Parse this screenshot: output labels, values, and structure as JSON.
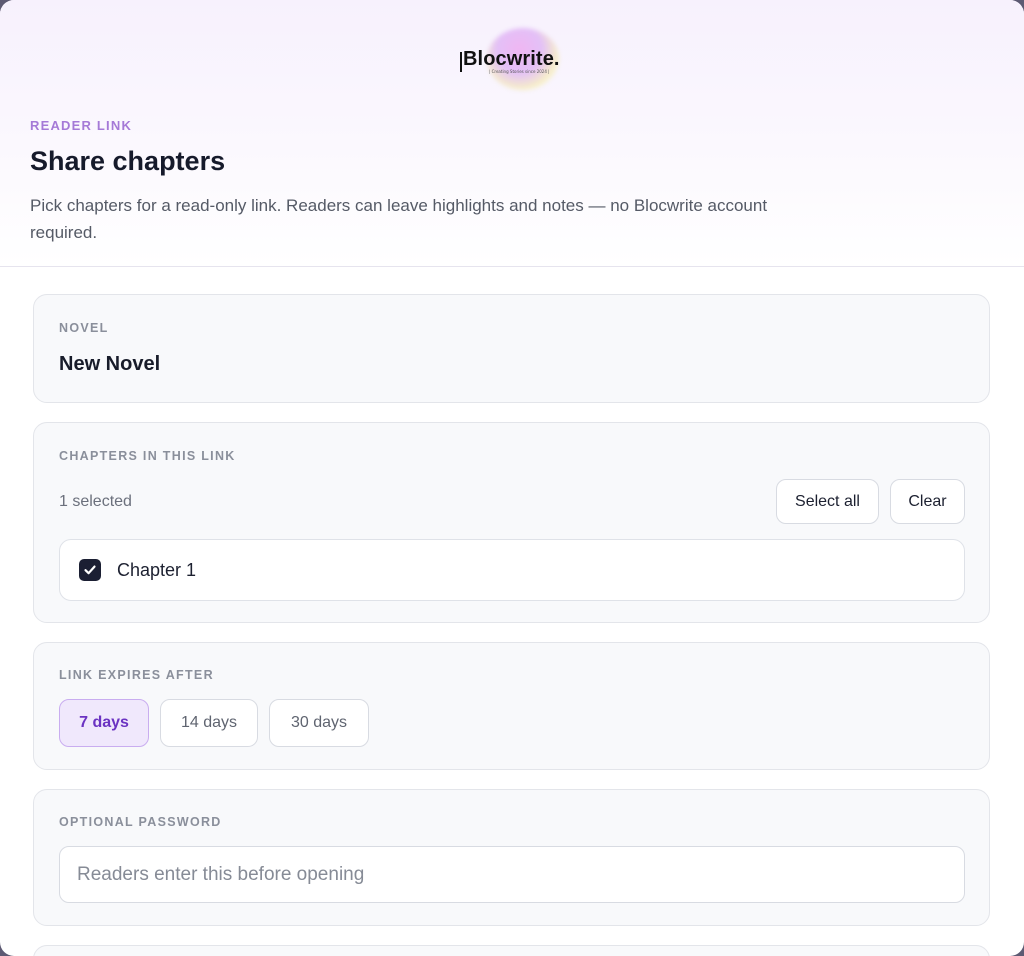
{
  "brand": {
    "name": "Blocwrite.",
    "tagline": "| Creating Stories since 2024 |"
  },
  "header": {
    "eyebrow": "READER LINK",
    "title": "Share chapters",
    "description": "Pick chapters for a read-only link. Readers can leave highlights and notes — no Blocwrite account required."
  },
  "novel": {
    "label": "NOVEL",
    "name": "New Novel"
  },
  "chapters": {
    "label": "CHAPTERS IN THIS LINK",
    "selected_count": "1 selected",
    "select_all_label": "Select all",
    "clear_label": "Clear",
    "items": [
      {
        "label": "Chapter 1",
        "checked": true
      }
    ]
  },
  "expiry": {
    "label": "LINK EXPIRES AFTER",
    "options": [
      {
        "label": "7 days",
        "active": true
      },
      {
        "label": "14 days",
        "active": false
      },
      {
        "label": "30 days",
        "active": false
      }
    ]
  },
  "password": {
    "label": "OPTIONAL PASSWORD",
    "value": "",
    "placeholder": "Readers enter this before opening"
  },
  "colors": {
    "accent": "#6b33c2",
    "accent_bg": "#f0e8fc",
    "eyebrow": "#a57ad7",
    "checkbox": "#1b1f33"
  }
}
